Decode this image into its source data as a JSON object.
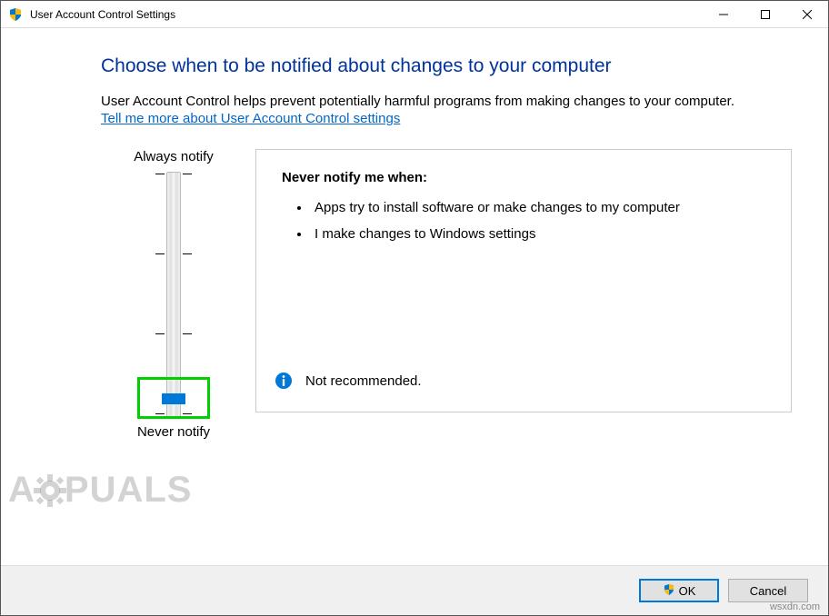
{
  "titlebar": {
    "title": "User Account Control Settings"
  },
  "heading": "Choose when to be notified about changes to your computer",
  "description": "User Account Control helps prevent potentially harmful programs from making changes to your computer.",
  "link": "Tell me more about User Account Control settings",
  "slider": {
    "top_label": "Always notify",
    "bottom_label": "Never notify"
  },
  "panel": {
    "title": "Never notify me when:",
    "items": [
      "Apps try to install software or make changes to my computer",
      "I make changes to Windows settings"
    ],
    "recommendation": "Not recommended."
  },
  "buttons": {
    "ok": "OK",
    "cancel": "Cancel"
  },
  "watermark": "A  PUALS",
  "source": "wsxdn.com"
}
